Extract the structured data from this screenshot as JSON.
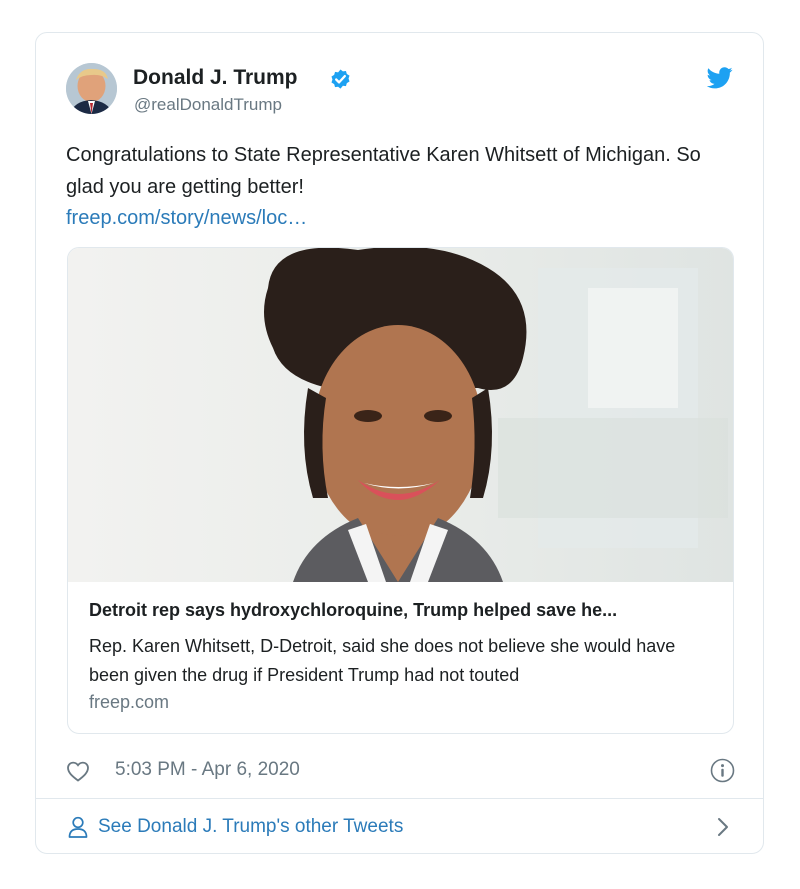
{
  "tweet": {
    "author_name": "Donald J. Trump",
    "author_handle": "@realDonaldTrump",
    "text": "Congratulations to State Representative Karen Whitsett of Michigan. So glad you are getting better!",
    "link": "freep.com/story/news/loc…",
    "timestamp": "5:03 PM - Apr 6, 2020"
  },
  "preview": {
    "title": "Detroit rep says hydroxychloroquine, Trump helped save he...",
    "description": "Rep. Karen Whitsett, D-Detroit, said she does not believe she would have been given the drug if President Trump had not touted",
    "domain": "freep.com"
  },
  "footer": {
    "see_more": "See Donald J. Trump's other Tweets"
  },
  "icons": {
    "avatar": "author-avatar",
    "verified": "verified-badge-icon",
    "bird": "twitter-bird-icon",
    "like": "heart-icon",
    "info": "info-icon",
    "profile": "person-icon",
    "chevron": "chevron-right-icon"
  },
  "colors": {
    "accent": "#1da1f2",
    "link": "#2b7bb9",
    "muted": "#697882",
    "border": "#e1e8ed",
    "text": "#1c2022"
  }
}
